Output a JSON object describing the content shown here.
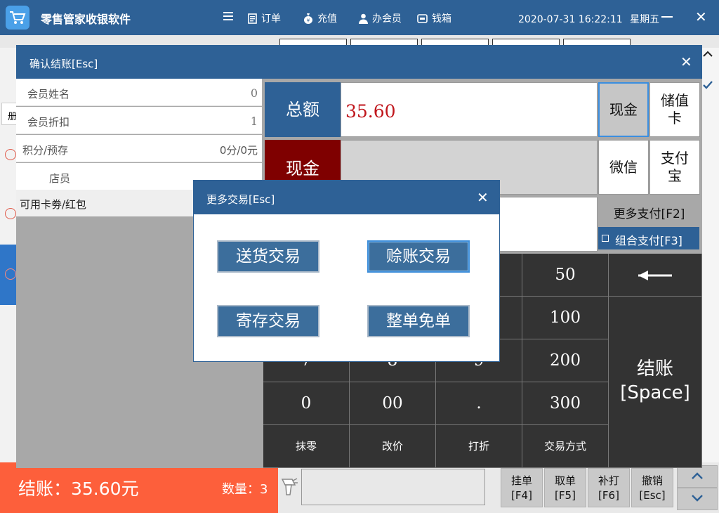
{
  "titlebar": {
    "app_title": "零售管家收银软件",
    "nav": [
      "订单",
      "充值",
      "办会员",
      "钱箱"
    ],
    "datetime": "2020-07-31 16:22:11",
    "weekday": "星期五"
  },
  "background": {
    "left_tab_fragment": "册"
  },
  "checkout_dialog": {
    "title": "确认结账[Esc]",
    "member_name_label": "会员姓名",
    "member_name_value": "0",
    "member_discount_label": "会员折扣",
    "member_discount_value": "1",
    "points_label": "积分/预存",
    "points_value": "0分/0元",
    "clerk_label": "店员",
    "coupons_label": "可用卡劵/红包",
    "total_label": "总额",
    "total_value": "35.60",
    "cash_label": "现金",
    "payment_methods": [
      "现金",
      "储值卡",
      "微信",
      "支付宝"
    ],
    "more_pay": "更多支付[F2]",
    "combo_pay": "组合支付[F3]",
    "keypad": {
      "row1": [
        "50"
      ],
      "row2": [
        "100"
      ],
      "row3": [
        "7",
        "8",
        "9",
        "200"
      ],
      "row4": [
        "0",
        "00",
        ".",
        "300"
      ],
      "row5": [
        "抹零",
        "改价",
        "打折",
        "交易方式"
      ],
      "backspace_symbol": "←",
      "checkout_line1": "结账",
      "checkout_line2": "[Space]"
    }
  },
  "more_transactions_dialog": {
    "title": "更多交易[Esc]",
    "buttons": [
      "送货交易",
      "赊账交易",
      "寄存交易",
      "整单免单"
    ]
  },
  "bottombar": {
    "checkout_summary": "结账：35.60元",
    "quantity": "数量：3",
    "function_buttons": [
      {
        "line1": "挂单",
        "line2": "[F4]"
      },
      {
        "line1": "取单",
        "line2": "[F5]"
      },
      {
        "line1": "补打",
        "line2": "[F6]"
      },
      {
        "line1": "撤销",
        "line2": "[Esc]"
      }
    ]
  },
  "colors": {
    "title_blue": "#2e6196",
    "accent_red": "#fd5f3b",
    "total_red": "#c0161c",
    "cash_darkred": "#7f0000",
    "keypad_dark": "#333333"
  }
}
